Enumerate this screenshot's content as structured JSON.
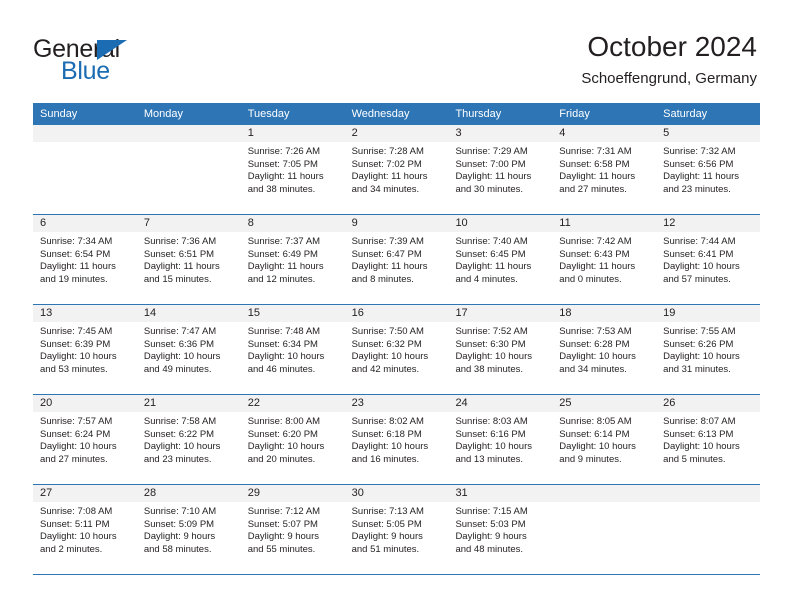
{
  "brand": {
    "name_top": "General",
    "name_bottom": "Blue",
    "accent_color": "#1b6cb3"
  },
  "header": {
    "title": "October 2024",
    "subtitle": "Schoeffengrund, Germany"
  },
  "theme": {
    "header_blue": "#2e75b6",
    "daynum_band": "#f2f2f2",
    "text": "#231f20"
  },
  "weekdays": [
    "Sunday",
    "Monday",
    "Tuesday",
    "Wednesday",
    "Thursday",
    "Friday",
    "Saturday"
  ],
  "weeks": [
    [
      {
        "day": "",
        "lines": []
      },
      {
        "day": "",
        "lines": []
      },
      {
        "day": "1",
        "lines": [
          "Sunrise: 7:26 AM",
          "Sunset: 7:05 PM",
          "Daylight: 11 hours",
          "and 38 minutes."
        ]
      },
      {
        "day": "2",
        "lines": [
          "Sunrise: 7:28 AM",
          "Sunset: 7:02 PM",
          "Daylight: 11 hours",
          "and 34 minutes."
        ]
      },
      {
        "day": "3",
        "lines": [
          "Sunrise: 7:29 AM",
          "Sunset: 7:00 PM",
          "Daylight: 11 hours",
          "and 30 minutes."
        ]
      },
      {
        "day": "4",
        "lines": [
          "Sunrise: 7:31 AM",
          "Sunset: 6:58 PM",
          "Daylight: 11 hours",
          "and 27 minutes."
        ]
      },
      {
        "day": "5",
        "lines": [
          "Sunrise: 7:32 AM",
          "Sunset: 6:56 PM",
          "Daylight: 11 hours",
          "and 23 minutes."
        ]
      }
    ],
    [
      {
        "day": "6",
        "lines": [
          "Sunrise: 7:34 AM",
          "Sunset: 6:54 PM",
          "Daylight: 11 hours",
          "and 19 minutes."
        ]
      },
      {
        "day": "7",
        "lines": [
          "Sunrise: 7:36 AM",
          "Sunset: 6:51 PM",
          "Daylight: 11 hours",
          "and 15 minutes."
        ]
      },
      {
        "day": "8",
        "lines": [
          "Sunrise: 7:37 AM",
          "Sunset: 6:49 PM",
          "Daylight: 11 hours",
          "and 12 minutes."
        ]
      },
      {
        "day": "9",
        "lines": [
          "Sunrise: 7:39 AM",
          "Sunset: 6:47 PM",
          "Daylight: 11 hours",
          "and 8 minutes."
        ]
      },
      {
        "day": "10",
        "lines": [
          "Sunrise: 7:40 AM",
          "Sunset: 6:45 PM",
          "Daylight: 11 hours",
          "and 4 minutes."
        ]
      },
      {
        "day": "11",
        "lines": [
          "Sunrise: 7:42 AM",
          "Sunset: 6:43 PM",
          "Daylight: 11 hours",
          "and 0 minutes."
        ]
      },
      {
        "day": "12",
        "lines": [
          "Sunrise: 7:44 AM",
          "Sunset: 6:41 PM",
          "Daylight: 10 hours",
          "and 57 minutes."
        ]
      }
    ],
    [
      {
        "day": "13",
        "lines": [
          "Sunrise: 7:45 AM",
          "Sunset: 6:39 PM",
          "Daylight: 10 hours",
          "and 53 minutes."
        ]
      },
      {
        "day": "14",
        "lines": [
          "Sunrise: 7:47 AM",
          "Sunset: 6:36 PM",
          "Daylight: 10 hours",
          "and 49 minutes."
        ]
      },
      {
        "day": "15",
        "lines": [
          "Sunrise: 7:48 AM",
          "Sunset: 6:34 PM",
          "Daylight: 10 hours",
          "and 46 minutes."
        ]
      },
      {
        "day": "16",
        "lines": [
          "Sunrise: 7:50 AM",
          "Sunset: 6:32 PM",
          "Daylight: 10 hours",
          "and 42 minutes."
        ]
      },
      {
        "day": "17",
        "lines": [
          "Sunrise: 7:52 AM",
          "Sunset: 6:30 PM",
          "Daylight: 10 hours",
          "and 38 minutes."
        ]
      },
      {
        "day": "18",
        "lines": [
          "Sunrise: 7:53 AM",
          "Sunset: 6:28 PM",
          "Daylight: 10 hours",
          "and 34 minutes."
        ]
      },
      {
        "day": "19",
        "lines": [
          "Sunrise: 7:55 AM",
          "Sunset: 6:26 PM",
          "Daylight: 10 hours",
          "and 31 minutes."
        ]
      }
    ],
    [
      {
        "day": "20",
        "lines": [
          "Sunrise: 7:57 AM",
          "Sunset: 6:24 PM",
          "Daylight: 10 hours",
          "and 27 minutes."
        ]
      },
      {
        "day": "21",
        "lines": [
          "Sunrise: 7:58 AM",
          "Sunset: 6:22 PM",
          "Daylight: 10 hours",
          "and 23 minutes."
        ]
      },
      {
        "day": "22",
        "lines": [
          "Sunrise: 8:00 AM",
          "Sunset: 6:20 PM",
          "Daylight: 10 hours",
          "and 20 minutes."
        ]
      },
      {
        "day": "23",
        "lines": [
          "Sunrise: 8:02 AM",
          "Sunset: 6:18 PM",
          "Daylight: 10 hours",
          "and 16 minutes."
        ]
      },
      {
        "day": "24",
        "lines": [
          "Sunrise: 8:03 AM",
          "Sunset: 6:16 PM",
          "Daylight: 10 hours",
          "and 13 minutes."
        ]
      },
      {
        "day": "25",
        "lines": [
          "Sunrise: 8:05 AM",
          "Sunset: 6:14 PM",
          "Daylight: 10 hours",
          "and 9 minutes."
        ]
      },
      {
        "day": "26",
        "lines": [
          "Sunrise: 8:07 AM",
          "Sunset: 6:13 PM",
          "Daylight: 10 hours",
          "and 5 minutes."
        ]
      }
    ],
    [
      {
        "day": "27",
        "lines": [
          "Sunrise: 7:08 AM",
          "Sunset: 5:11 PM",
          "Daylight: 10 hours",
          "and 2 minutes."
        ]
      },
      {
        "day": "28",
        "lines": [
          "Sunrise: 7:10 AM",
          "Sunset: 5:09 PM",
          "Daylight: 9 hours",
          "and 58 minutes."
        ]
      },
      {
        "day": "29",
        "lines": [
          "Sunrise: 7:12 AM",
          "Sunset: 5:07 PM",
          "Daylight: 9 hours",
          "and 55 minutes."
        ]
      },
      {
        "day": "30",
        "lines": [
          "Sunrise: 7:13 AM",
          "Sunset: 5:05 PM",
          "Daylight: 9 hours",
          "and 51 minutes."
        ]
      },
      {
        "day": "31",
        "lines": [
          "Sunrise: 7:15 AM",
          "Sunset: 5:03 PM",
          "Daylight: 9 hours",
          "and 48 minutes."
        ]
      },
      {
        "day": "",
        "lines": []
      },
      {
        "day": "",
        "lines": []
      }
    ]
  ]
}
